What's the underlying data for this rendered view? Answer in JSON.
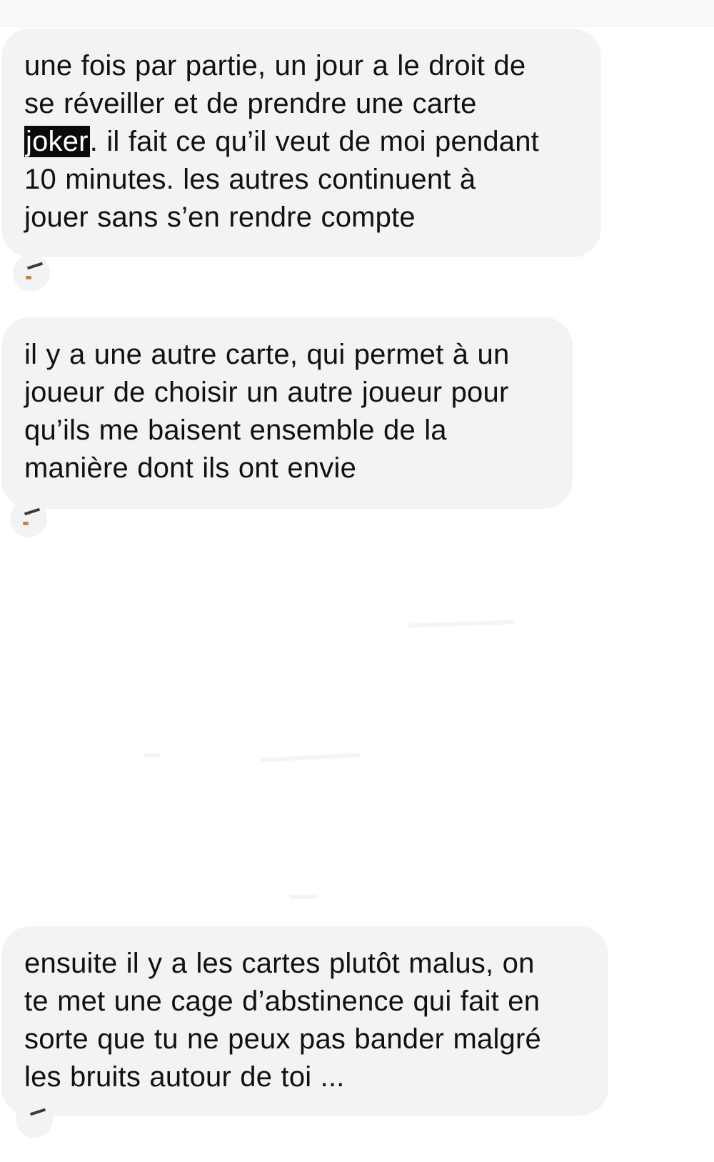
{
  "messages": [
    {
      "lines": [
        {
          "text": "une fois par partie, un jour a le droit de"
        },
        {
          "text": "se réveiller et de prendre une carte"
        },
        {
          "highlight": "joker",
          "rest": ". il fait ce qu’il veut de moi pendant"
        },
        {
          "text": "10 minutes. les autres continuent à"
        },
        {
          "text": "jouer sans s’en rendre compte"
        }
      ]
    },
    {
      "lines": [
        {
          "text": "il y a une autre carte, qui permet à un"
        },
        {
          "text": "joueur de choisir un autre joueur pour"
        },
        {
          "text": "qu’ils me baisent ensemble de la"
        },
        {
          "text": "manière dont ils ont envie"
        }
      ]
    },
    {
      "lines": [
        {
          "text": "ensuite il y a les cartes plutôt malus, on"
        },
        {
          "text": "te met une cage d’abstinence qui fait en"
        },
        {
          "text": "sorte que tu ne peux pas bander malgré"
        },
        {
          "text": "les bruits autour de toi ..."
        }
      ]
    }
  ],
  "colors": {
    "bubble_background": "#f2f3f5",
    "highlight_background": "#0a0a0a",
    "highlight_text": "#ffffff",
    "text": "#111111"
  },
  "icons": {
    "sender_avatar": "avatar-icon"
  }
}
